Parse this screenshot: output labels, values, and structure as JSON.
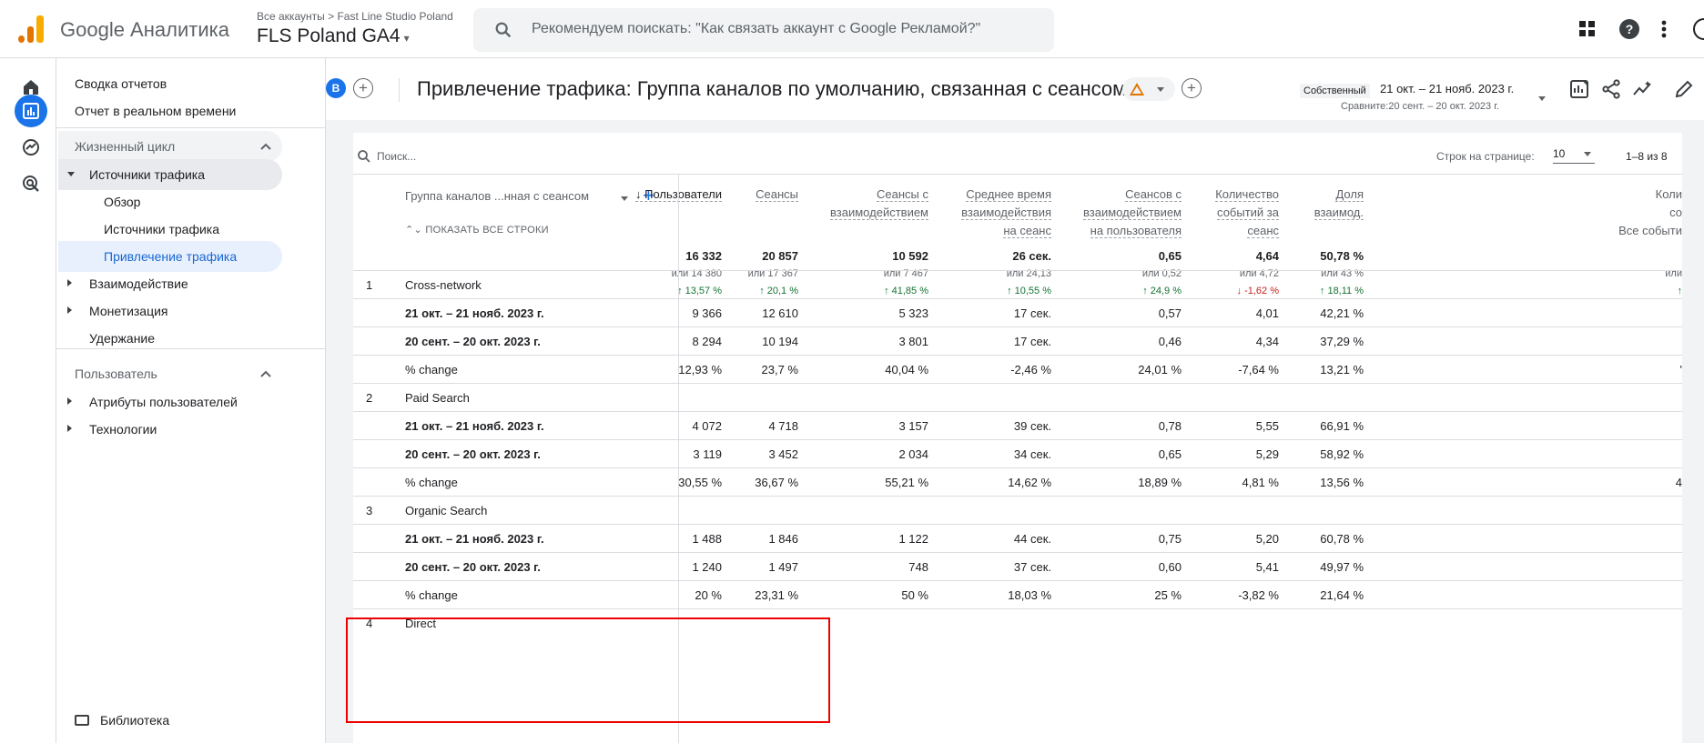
{
  "topbar": {
    "product": "Google Аналитика",
    "breadcrumb_all": "Все аккаунты",
    "breadcrumb_account": "Fast Line Studio Poland",
    "property": "FLS Poland GA4",
    "search_placeholder": "Рекомендуем поискать: \"Как связать аккаунт с Google Рекламой?\""
  },
  "nav": {
    "summary": "Сводка отчетов",
    "realtime": "Отчет в реальном времени",
    "lifecycle": "Жизненный цикл",
    "acquisition": "Источники трафика",
    "overview": "Обзор",
    "user_acq": "Источники трафика",
    "traffic_acq": "Привлечение трафика",
    "engagement": "Взаимодействие",
    "monetization": "Монетизация",
    "retention": "Удержание",
    "user_section": "Пользователь",
    "user_attrs": "Атрибуты пользователей",
    "tech": "Технологии",
    "library": "Библиотека"
  },
  "report": {
    "chip": "B",
    "title": "Привлечение трафика: Группа каналов по умолчанию, связанная с сеансом",
    "date_type": "Собственный",
    "date_range": "21 окт. – 21 нояб. 2023 г.",
    "date_compare": "Сравните:20 сент. – 20 окт. 2023 г."
  },
  "table": {
    "search_placeholder": "Поиск...",
    "rows_per_page_label": "Строк на странице:",
    "rows_per_page": "10",
    "pager": "1–8 из 8",
    "dimension": "Группа каналов ...нная с сеансом",
    "show_all": "ПОКАЗАТЬ ВСЕ СТРОКИ",
    "columns": [
      {
        "l1": "↓ Пользователи",
        "l2": "",
        "l3": ""
      },
      {
        "l1": "Сеансы",
        "l2": "",
        "l3": ""
      },
      {
        "l1": "Сеансы с",
        "l2": "взаимодействием",
        "l3": ""
      },
      {
        "l1": "Среднее время",
        "l2": "взаимодействия",
        "l3": "на сеанс"
      },
      {
        "l1": "Сеансов с",
        "l2": "взаимодействием",
        "l3": "на пользователя"
      },
      {
        "l1": "Количество",
        "l2": "событий за",
        "l3": "сеанс"
      },
      {
        "l1": "Доля",
        "l2": "взаимод.",
        "l3": ""
      },
      {
        "l1": "Коли",
        "l2": "со",
        "l3": "Все событи"
      }
    ],
    "totals": [
      {
        "v": "16 332",
        "prev": "или 14 380",
        "chg": "↑ 13,57 %",
        "dir": "up"
      },
      {
        "v": "20 857",
        "prev": "или 17 367",
        "chg": "↑ 20,1 %",
        "dir": "up"
      },
      {
        "v": "10 592",
        "prev": "или 7 467",
        "chg": "↑ 41,85 %",
        "dir": "up"
      },
      {
        "v": "26 сек.",
        "prev": "или 24,13",
        "chg": "↑ 10,55 %",
        "dir": "up"
      },
      {
        "v": "0,65",
        "prev": "или 0,52",
        "chg": "↑ 24,9 %",
        "dir": "up"
      },
      {
        "v": "4,64",
        "prev": "или 4,72",
        "chg": "↓ -1,62 %",
        "dir": "down"
      },
      {
        "v": "50,78 %",
        "prev": "или 43 %",
        "chg": "↑ 18,11 %",
        "dir": "up"
      },
      {
        "v": "",
        "prev": "или",
        "chg": "↑",
        "dir": "up"
      }
    ],
    "rows": [
      {
        "num": "1",
        "name": "Cross-network",
        "bold": false,
        "cells": [
          "",
          "",
          "",
          "",
          "",
          "",
          "",
          ""
        ]
      },
      {
        "num": "",
        "name": "21 окт. – 21 нояб. 2023 г.",
        "bold": true,
        "cells": [
          "9 366",
          "12 610",
          "5 323",
          "17 сек.",
          "0,57",
          "4,01",
          "42,21 %",
          ""
        ]
      },
      {
        "num": "",
        "name": "20 сент. – 20 окт. 2023 г.",
        "bold": true,
        "cells": [
          "8 294",
          "10 194",
          "3 801",
          "17 сек.",
          "0,46",
          "4,34",
          "37,29 %",
          ""
        ]
      },
      {
        "num": "",
        "name": "% change",
        "bold": false,
        "cells": [
          "12,93 %",
          "23,7 %",
          "40,04 %",
          "-2,46 %",
          "24,01 %",
          "-7,64 %",
          "13,21 %",
          "'"
        ]
      },
      {
        "num": "2",
        "name": "Paid Search",
        "bold": false,
        "cells": [
          "",
          "",
          "",
          "",
          "",
          "",
          "",
          ""
        ]
      },
      {
        "num": "",
        "name": "21 окт. – 21 нояб. 2023 г.",
        "bold": true,
        "cells": [
          "4 072",
          "4 718",
          "3 157",
          "39 сек.",
          "0,78",
          "5,55",
          "66,91 %",
          ""
        ]
      },
      {
        "num": "",
        "name": "20 сент. – 20 окт. 2023 г.",
        "bold": true,
        "cells": [
          "3 119",
          "3 452",
          "2 034",
          "34 сек.",
          "0,65",
          "5,29",
          "58,92 %",
          ""
        ]
      },
      {
        "num": "",
        "name": "% change",
        "bold": false,
        "cells": [
          "30,55 %",
          "36,67 %",
          "55,21 %",
          "14,62 %",
          "18,89 %",
          "4,81 %",
          "13,56 %",
          "4"
        ]
      },
      {
        "num": "3",
        "name": "Organic Search",
        "bold": false,
        "cells": [
          "",
          "",
          "",
          "",
          "",
          "",
          "",
          ""
        ]
      },
      {
        "num": "",
        "name": "21 окт. – 21 нояб. 2023 г.",
        "bold": true,
        "cells": [
          "1 488",
          "1 846",
          "1 122",
          "44 сек.",
          "0,75",
          "5,20",
          "60,78 %",
          ""
        ]
      },
      {
        "num": "",
        "name": "20 сент. – 20 окт. 2023 г.",
        "bold": true,
        "cells": [
          "1 240",
          "1 497",
          "748",
          "37 сек.",
          "0,60",
          "5,41",
          "49,97 %",
          ""
        ]
      },
      {
        "num": "",
        "name": "% change",
        "bold": false,
        "cells": [
          "20 %",
          "23,31 %",
          "50 %",
          "18,03 %",
          "25 %",
          "-3,82 %",
          "21,64 %",
          ""
        ]
      },
      {
        "num": "4",
        "name": "Direct",
        "bold": false,
        "cells": [
          "",
          "",
          "",
          "",
          "",
          "",
          "",
          ""
        ]
      }
    ]
  }
}
